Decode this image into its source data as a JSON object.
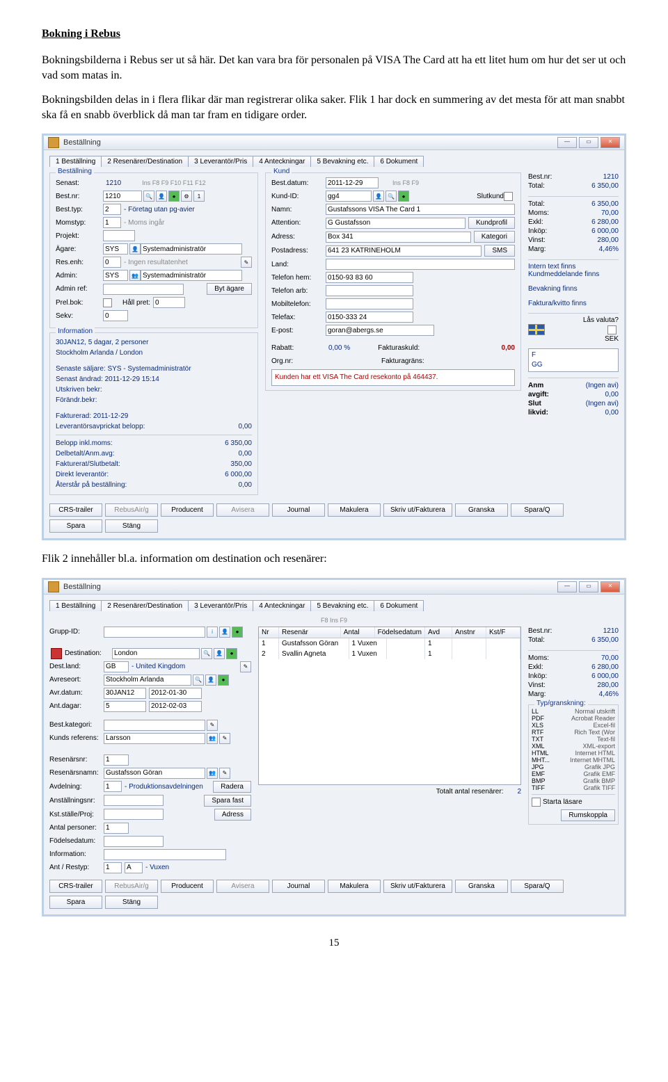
{
  "doc": {
    "title": "Bokning i Rebus",
    "para1": "Bokningsbilderna i Rebus ser ut så här. Det kan vara bra för personalen på VISA The Card att ha ett litet hum om hur det ser ut och vad som matas in.",
    "para2": "Bokningsbilden delas in i flera flikar där man registrerar olika saker. Flik 1 har dock en summering av det mesta för att man snabbt ska få en snabb överblick då man tar fram en tidigare order.",
    "para3": "Flik 2 innehåller bl.a. information om destination och resenärer:",
    "pagenum": "15"
  },
  "scr1": {
    "wintitle": "Beställning",
    "tabs": [
      "1 Beställning",
      "2 Resenärer/Destination",
      "3 Leverantör/Pris",
      "4 Anteckningar",
      "5 Bevakning etc.",
      "6 Dokument"
    ],
    "legend1": "Beställning",
    "senast_lbl": "Senast:",
    "senast": "1210",
    "funckeys": "Ins    F8    F9    F10   F11   F12",
    "bestnr_lbl": "Best.nr:",
    "bestnr": "1210",
    "besttyp_lbl": "Best.typ:",
    "besttyp": "2",
    "besttyp_t": "- Företag utan pg-avier",
    "momstyp_lbl": "Momstyp:",
    "momstyp": "1",
    "momstyp_t": "- Moms ingår",
    "projekt_lbl": "Projekt:",
    "agare_lbl": "Ägare:",
    "agare": "SYS",
    "agare_t": "Systemadministratör",
    "resenh_lbl": "Res.enh:",
    "resenh": "0",
    "resenh_t": "- Ingen resultatenhet",
    "admin_lbl": "Admin:",
    "admin": "SYS",
    "admin_t": "Systemadministratör",
    "adminref_lbl": "Admin ref:",
    "bytagare": "Byt ägare",
    "prelbok_lbl": "Prel.bok:",
    "hallpret_lbl": "Håll pret:",
    "hallpret": "0",
    "sekv_lbl": "Sekv:",
    "sekv": "0",
    "info_legend": "Information",
    "info1": "30JAN12, 5 dagar, 2 personer",
    "info2": "Stockholm Arlanda / London",
    "info3": "Senaste säljare: SYS - Systemadministratör",
    "info4": "Senast ändrad:  2011-12-29 15:14",
    "info5": "Utskriven bekr:",
    "info6": "Förändr.bekr:",
    "info7": "Fakturerad: 2011-12-29",
    "info8_l": "Leverantörsavprickat belopp:",
    "info8_v": "0,00",
    "sum1_l": "Belopp inkl.moms:",
    "sum1_v": "6 350,00",
    "sum2_l": "Delbetalt/Anm.avg:",
    "sum2_v": "0,00",
    "sum3_l": "Fakturerat/Slutbetalt:",
    "sum3_v": "350,00",
    "sum4_l": "Direkt leverantör:",
    "sum4_v": "6 000,00",
    "sum5_l": "Återstår på beställning:",
    "sum5_v": "0,00",
    "legend2": "Kund",
    "bestdatum_lbl": "Best.datum:",
    "bestdatum": "2011-12-29",
    "funckeys2": "Ins    F8    F9",
    "kundid_lbl": "Kund-ID:",
    "kundid": "gg4",
    "slutkund": "Slutkund",
    "namn_lbl": "Namn:",
    "namn": "Gustafssons VISA The Card 1",
    "attention_lbl": "Attention:",
    "attention": "G Gustafsson",
    "adress_lbl": "Adress:",
    "adress": "Box 341",
    "postadress_lbl": "Postadress:",
    "postadress": "641 23 KATRINEHOLM",
    "land_lbl": "Land:",
    "telhem_lbl": "Telefon hem:",
    "telhem": "0150-93 83 60",
    "telarb_lbl": "Telefon arb:",
    "mobil_lbl": "Mobiltelefon:",
    "telefax_lbl": "Telefax:",
    "telefax": "0150-333 24",
    "epost_lbl": "E-post:",
    "epost": "goran@abergs.se",
    "rabatt_lbl": "Rabatt:",
    "rabatt": "0,00 %",
    "fakturaskuld_lbl": "Fakturaskuld:",
    "fakturaskuld": "0,00",
    "orgnr_lbl": "Org.nr:",
    "fakturagrans_lbl": "Fakturagräns:",
    "kundnote": "Kunden har ett VISA The Card resekonto på 464437.",
    "kundprofil": "Kundprofil",
    "kategori": "Kategori",
    "sms": "SMS",
    "side_bestnr_l": "Best.nr:",
    "side_bestnr_v": "1210",
    "side_total_l": "Total:",
    "side_total_v": "6 350,00",
    "side_total2_l": "Total:",
    "side_total2_v": "6 350,00",
    "side_moms_l": "Moms:",
    "side_moms_v": "70,00",
    "side_exkl_l": "Exkl:",
    "side_exkl_v": "6 280,00",
    "side_inkop_l": "Inköp:",
    "side_inkop_v": "6 000,00",
    "side_vinst_l": "Vinst:",
    "side_vinst_v": "280,00",
    "side_marg_l": "Marg:",
    "side_marg_v": "4,46%",
    "side_intern": "Intern text finns",
    "side_kundmed": "Kundmeddelande finns",
    "side_bevak": "Bevakning finns",
    "side_faktura": "Faktura/kvitto finns",
    "lasvaluta": "Lås valuta?",
    "sek": "SEK",
    "side_f": "F",
    "side_gg": "GG",
    "anm_l": "Anm",
    "anm_v": "(Ingen avi)",
    "avgift_l": "avgift:",
    "avgift_v": "0,00",
    "slut_l": "Slut",
    "slut_v": "(Ingen avi)",
    "likvid_l": "likvid:",
    "likvid_v": "0,00",
    "btns": [
      "CRS-trailer",
      "RebusAir/g",
      "Producent",
      "Avisera",
      "Journal",
      "Makulera",
      "Skriv ut/Fakturera",
      "Granska",
      "Spara/Q",
      "Spara",
      "Stäng"
    ]
  },
  "scr2": {
    "wintitle": "Beställning",
    "tabs": [
      "1 Beställning",
      "2 Resenärer/Destination",
      "3 Leverantör/Pris",
      "4 Anteckningar",
      "5 Bevakning etc.",
      "6 Dokument"
    ],
    "fkeys": "F8    Ins    F9",
    "gruppid_lbl": "Grupp-ID:",
    "th": [
      "Nr",
      "Resenär",
      "Antal",
      "Födelsedatum",
      "Avd",
      "Anstnr",
      "Kst/F"
    ],
    "r1": [
      "1",
      "Gustafsson Göran",
      "1 Vuxen",
      "",
      "1",
      "",
      ""
    ],
    "r2": [
      "2",
      "Svallin Agneta",
      "1 Vuxen",
      "",
      "1",
      "",
      ""
    ],
    "dest_lbl": "Destination:",
    "dest": "London",
    "destland_lbl": "Dest.land:",
    "destland": "GB",
    "destland_t": "- United Kingdom",
    "avreseort_lbl": "Avreseort:",
    "avreseort": "Stockholm Arlanda",
    "avrdatum_lbl": "Avr.datum:",
    "avrdatum1": "30JAN12",
    "avrdatum2": "2012-01-30",
    "antdagar_lbl": "Ant.dagar:",
    "antdagar": "5",
    "antdagar2": "2012-02-03",
    "bestkat_lbl": "Best.kategori:",
    "kundref_lbl": "Kunds referens:",
    "kundref": "Larsson",
    "resenarsnr_lbl": "Resenärsnr:",
    "resenarsnr": "1",
    "resenarsnamn_lbl": "Resenärsnamn:",
    "resenarsnamn": "Gustafsson Göran",
    "avdelning_lbl": "Avdelning:",
    "avdelning": "1",
    "avdelning_t": "- Produktionsavdelningen",
    "anstallning_lbl": "Anställningsnr:",
    "kststalle_lbl": "Kst.ställe/Proj:",
    "antpers_lbl": "Antal personer:",
    "antpers": "1",
    "fodelse_lbl": "Födelsedatum:",
    "information_lbl": "Information:",
    "antrestyp_lbl": "Ant / Restyp:",
    "antrestyp": "1",
    "antrestyp2": "A",
    "antrestyp_t": "- Vuxen",
    "radera": "Radera",
    "sparafast": "Spara fast",
    "adressbtn": "Adress",
    "totalres_l": "Totalt antal resenärer:",
    "totalres_v": "2",
    "typlegend": "Typ/granskning:",
    "types": [
      [
        "LL",
        "Normal utskrift"
      ],
      [
        "PDF",
        "Acrobat Reader"
      ],
      [
        "XLS",
        "Excel-fil"
      ],
      [
        "RTF",
        "Rich Text (Wor"
      ],
      [
        "TXT",
        "Text-fil"
      ],
      [
        "XML",
        "XML-export"
      ],
      [
        "HTML",
        "Internet HTML"
      ],
      [
        "MHT...",
        "Internet MHTML"
      ],
      [
        "JPG",
        "Grafik JPG"
      ],
      [
        "EMF",
        "Grafik EMF"
      ],
      [
        "BMP",
        "Grafik BMP"
      ],
      [
        "TIFF",
        "Grafik TIFF"
      ]
    ],
    "startalasare": "Starta läsare",
    "rumskoppla": "Rumskoppla",
    "btns": [
      "CRS-trailer",
      "RebusAir/g",
      "Producent",
      "Avisera",
      "Journal",
      "Makulera",
      "Skriv ut/Fakturera",
      "Granska",
      "Spara/Q",
      "Spara",
      "Stäng"
    ]
  }
}
